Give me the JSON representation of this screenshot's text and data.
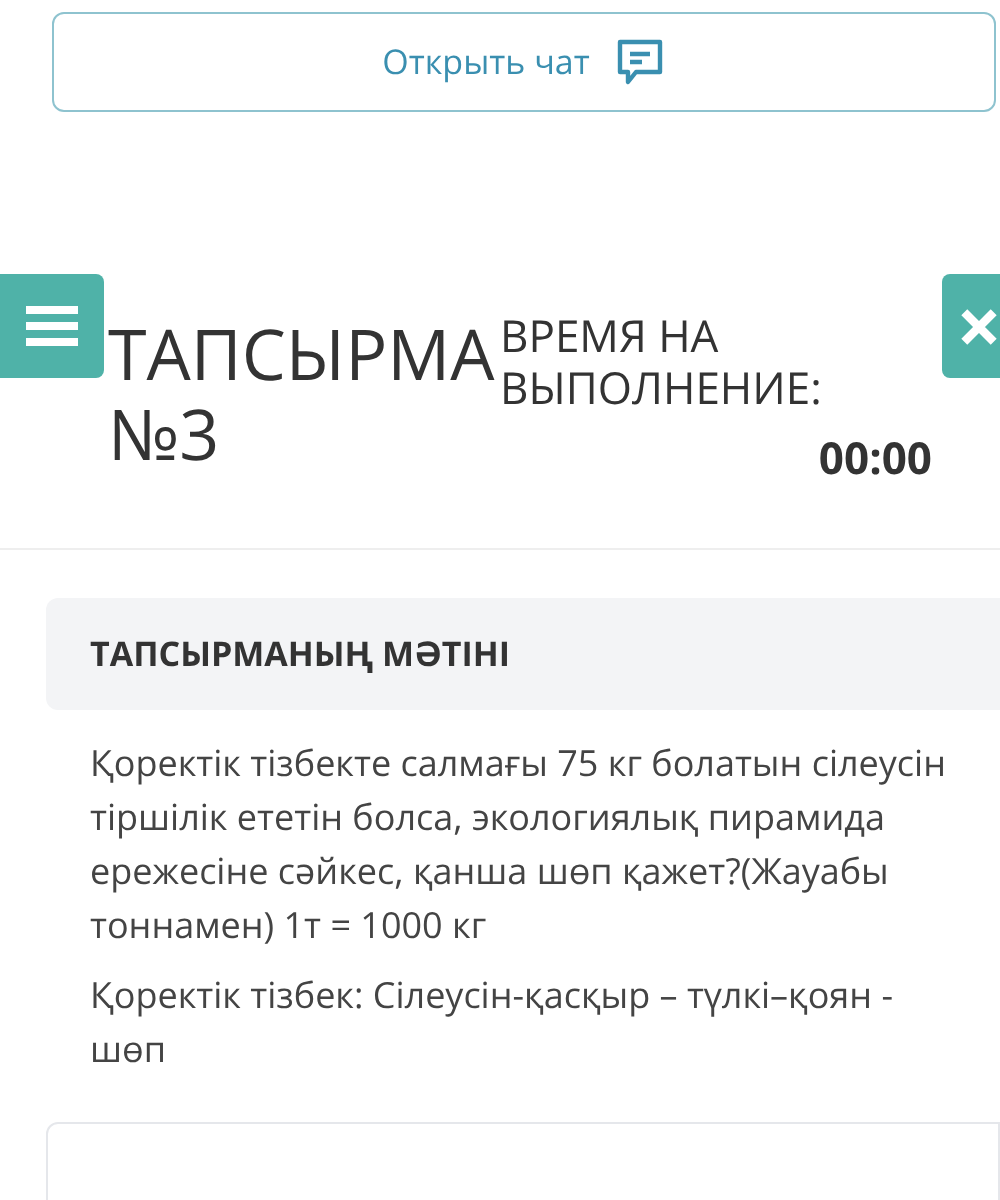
{
  "chat_button": {
    "label": "Открыть чат"
  },
  "task": {
    "title": "ТАПСЫРМА №3",
    "time_label": "ВРЕМЯ НА ВЫПОЛНЕНИЕ:",
    "time_value": "00:00"
  },
  "section": {
    "heading": "ТАПСЫРМАНЫҢ МӘТІНІ",
    "paragraphs": [
      "Қоректік тізбекте салмағы 75 кг болатын сілеусін тіршілік ететін болса, экологиялық пирамида ережесіне сәйкес, қанша шөп қажет?(Жауабы тоннамен) 1т = 1000 кг",
      "Қоректік тізбек: Сілеусін-қасқыр – түлкі–қоян - шөп"
    ]
  }
}
